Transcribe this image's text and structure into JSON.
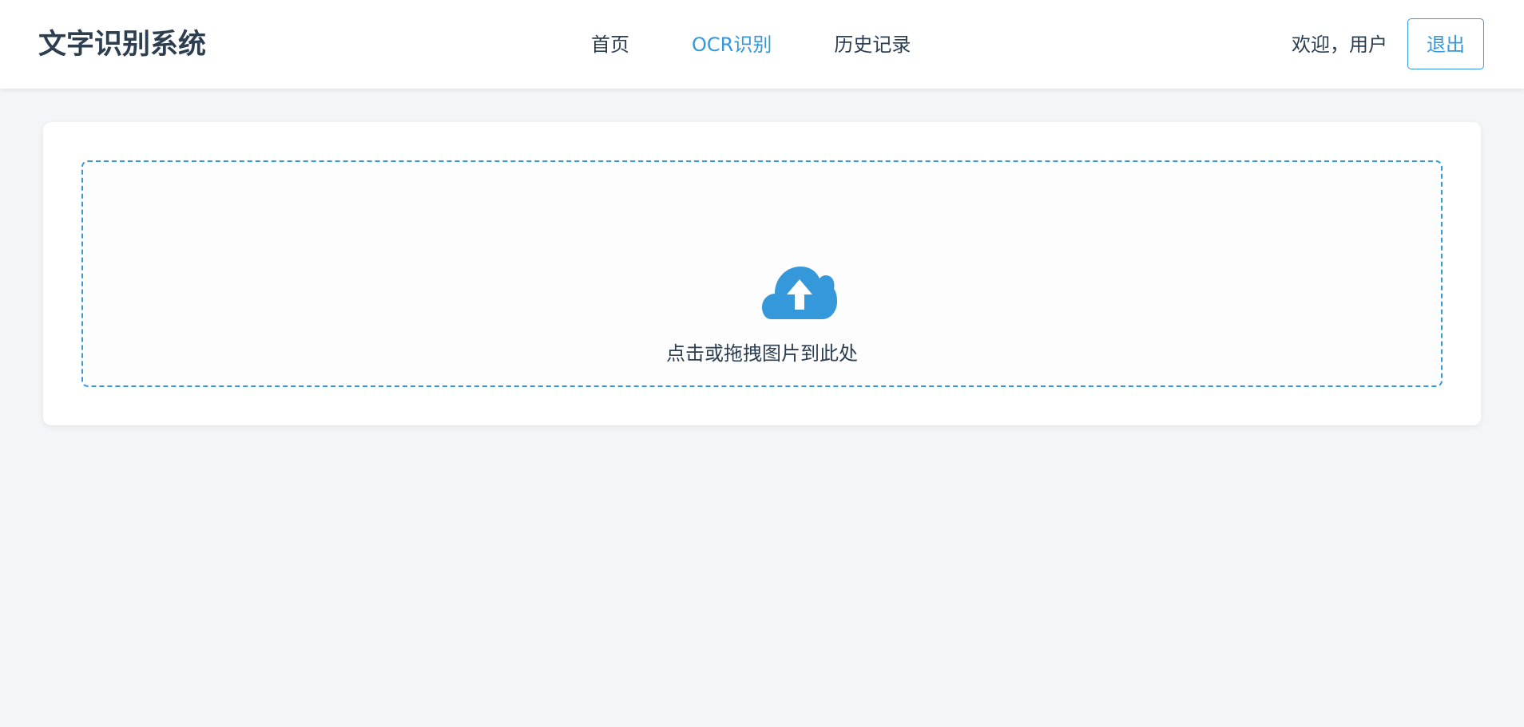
{
  "app": {
    "title": "文字识别系统"
  },
  "nav": {
    "items": [
      {
        "label": "首页",
        "active": false
      },
      {
        "label": "OCR识别",
        "active": true
      },
      {
        "label": "历史记录",
        "active": false
      }
    ]
  },
  "user": {
    "welcome": "欢迎，用户",
    "logout_label": "退出"
  },
  "upload": {
    "prompt": "点击或拖拽图片到此处",
    "icon": "cloud-upload-icon"
  },
  "colors": {
    "accent": "#3498db",
    "text": "#2c3e50",
    "background": "#f3f5f8"
  }
}
